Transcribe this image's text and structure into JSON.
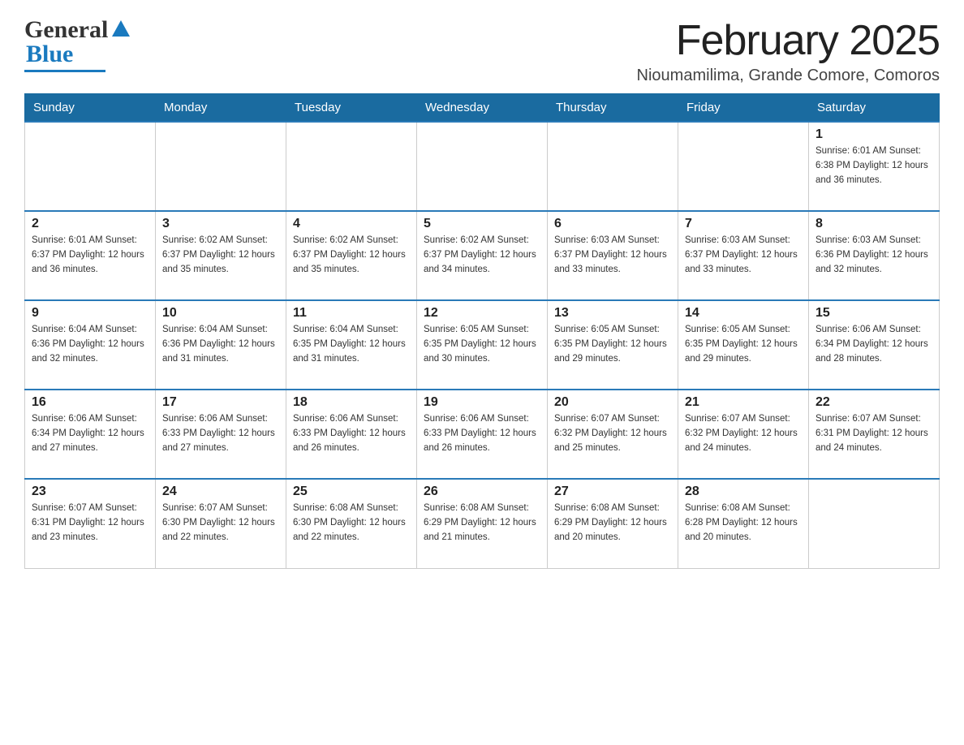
{
  "header": {
    "logo_general": "General",
    "logo_blue": "Blue",
    "month_title": "February 2025",
    "location": "Nioumamilima, Grande Comore, Comoros"
  },
  "days_of_week": [
    "Sunday",
    "Monday",
    "Tuesday",
    "Wednesday",
    "Thursday",
    "Friday",
    "Saturday"
  ],
  "weeks": [
    [
      {
        "day": "",
        "info": ""
      },
      {
        "day": "",
        "info": ""
      },
      {
        "day": "",
        "info": ""
      },
      {
        "day": "",
        "info": ""
      },
      {
        "day": "",
        "info": ""
      },
      {
        "day": "",
        "info": ""
      },
      {
        "day": "1",
        "info": "Sunrise: 6:01 AM\nSunset: 6:38 PM\nDaylight: 12 hours\nand 36 minutes."
      }
    ],
    [
      {
        "day": "2",
        "info": "Sunrise: 6:01 AM\nSunset: 6:37 PM\nDaylight: 12 hours\nand 36 minutes."
      },
      {
        "day": "3",
        "info": "Sunrise: 6:02 AM\nSunset: 6:37 PM\nDaylight: 12 hours\nand 35 minutes."
      },
      {
        "day": "4",
        "info": "Sunrise: 6:02 AM\nSunset: 6:37 PM\nDaylight: 12 hours\nand 35 minutes."
      },
      {
        "day": "5",
        "info": "Sunrise: 6:02 AM\nSunset: 6:37 PM\nDaylight: 12 hours\nand 34 minutes."
      },
      {
        "day": "6",
        "info": "Sunrise: 6:03 AM\nSunset: 6:37 PM\nDaylight: 12 hours\nand 33 minutes."
      },
      {
        "day": "7",
        "info": "Sunrise: 6:03 AM\nSunset: 6:37 PM\nDaylight: 12 hours\nand 33 minutes."
      },
      {
        "day": "8",
        "info": "Sunrise: 6:03 AM\nSunset: 6:36 PM\nDaylight: 12 hours\nand 32 minutes."
      }
    ],
    [
      {
        "day": "9",
        "info": "Sunrise: 6:04 AM\nSunset: 6:36 PM\nDaylight: 12 hours\nand 32 minutes."
      },
      {
        "day": "10",
        "info": "Sunrise: 6:04 AM\nSunset: 6:36 PM\nDaylight: 12 hours\nand 31 minutes."
      },
      {
        "day": "11",
        "info": "Sunrise: 6:04 AM\nSunset: 6:35 PM\nDaylight: 12 hours\nand 31 minutes."
      },
      {
        "day": "12",
        "info": "Sunrise: 6:05 AM\nSunset: 6:35 PM\nDaylight: 12 hours\nand 30 minutes."
      },
      {
        "day": "13",
        "info": "Sunrise: 6:05 AM\nSunset: 6:35 PM\nDaylight: 12 hours\nand 29 minutes."
      },
      {
        "day": "14",
        "info": "Sunrise: 6:05 AM\nSunset: 6:35 PM\nDaylight: 12 hours\nand 29 minutes."
      },
      {
        "day": "15",
        "info": "Sunrise: 6:06 AM\nSunset: 6:34 PM\nDaylight: 12 hours\nand 28 minutes."
      }
    ],
    [
      {
        "day": "16",
        "info": "Sunrise: 6:06 AM\nSunset: 6:34 PM\nDaylight: 12 hours\nand 27 minutes."
      },
      {
        "day": "17",
        "info": "Sunrise: 6:06 AM\nSunset: 6:33 PM\nDaylight: 12 hours\nand 27 minutes."
      },
      {
        "day": "18",
        "info": "Sunrise: 6:06 AM\nSunset: 6:33 PM\nDaylight: 12 hours\nand 26 minutes."
      },
      {
        "day": "19",
        "info": "Sunrise: 6:06 AM\nSunset: 6:33 PM\nDaylight: 12 hours\nand 26 minutes."
      },
      {
        "day": "20",
        "info": "Sunrise: 6:07 AM\nSunset: 6:32 PM\nDaylight: 12 hours\nand 25 minutes."
      },
      {
        "day": "21",
        "info": "Sunrise: 6:07 AM\nSunset: 6:32 PM\nDaylight: 12 hours\nand 24 minutes."
      },
      {
        "day": "22",
        "info": "Sunrise: 6:07 AM\nSunset: 6:31 PM\nDaylight: 12 hours\nand 24 minutes."
      }
    ],
    [
      {
        "day": "23",
        "info": "Sunrise: 6:07 AM\nSunset: 6:31 PM\nDaylight: 12 hours\nand 23 minutes."
      },
      {
        "day": "24",
        "info": "Sunrise: 6:07 AM\nSunset: 6:30 PM\nDaylight: 12 hours\nand 22 minutes."
      },
      {
        "day": "25",
        "info": "Sunrise: 6:08 AM\nSunset: 6:30 PM\nDaylight: 12 hours\nand 22 minutes."
      },
      {
        "day": "26",
        "info": "Sunrise: 6:08 AM\nSunset: 6:29 PM\nDaylight: 12 hours\nand 21 minutes."
      },
      {
        "day": "27",
        "info": "Sunrise: 6:08 AM\nSunset: 6:29 PM\nDaylight: 12 hours\nand 20 minutes."
      },
      {
        "day": "28",
        "info": "Sunrise: 6:08 AM\nSunset: 6:28 PM\nDaylight: 12 hours\nand 20 minutes."
      },
      {
        "day": "",
        "info": ""
      }
    ]
  ]
}
